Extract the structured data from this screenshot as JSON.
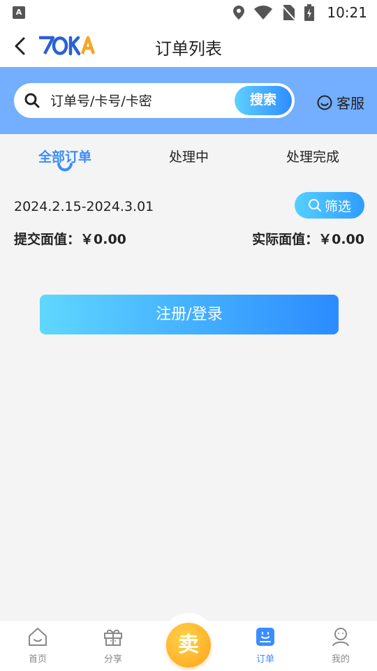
{
  "status_bar": {
    "time": "10:21",
    "left_icon": "A"
  },
  "app_bar": {
    "logo_text": "7OKA",
    "title": "订单列表"
  },
  "search": {
    "placeholder": "订单号/卡号/卡密",
    "button_label": "搜索"
  },
  "service": {
    "label": "客服"
  },
  "tabs": [
    {
      "label": "全部订单",
      "active": true
    },
    {
      "label": "处理中",
      "active": false
    },
    {
      "label": "处理完成",
      "active": false
    }
  ],
  "filter": {
    "date_range": "2024.2.15-2024.3.01",
    "button_label": "筛选"
  },
  "summary": {
    "submitted": "提交面值：￥0.00",
    "actual": "实际面值：￥0.00"
  },
  "cta": {
    "label": "注册/登录"
  },
  "bottom_nav": {
    "items": [
      {
        "label": "首页",
        "icon": "home-icon"
      },
      {
        "label": "分享",
        "icon": "gift-icon"
      },
      {
        "label": "订单",
        "icon": "order-icon",
        "active": true
      },
      {
        "label": "我的",
        "icon": "user-icon"
      }
    ],
    "sell_label": "卖"
  },
  "colors": {
    "accent": "#3a8dff",
    "band": "#73aeff",
    "sell": "#ffa21a"
  }
}
